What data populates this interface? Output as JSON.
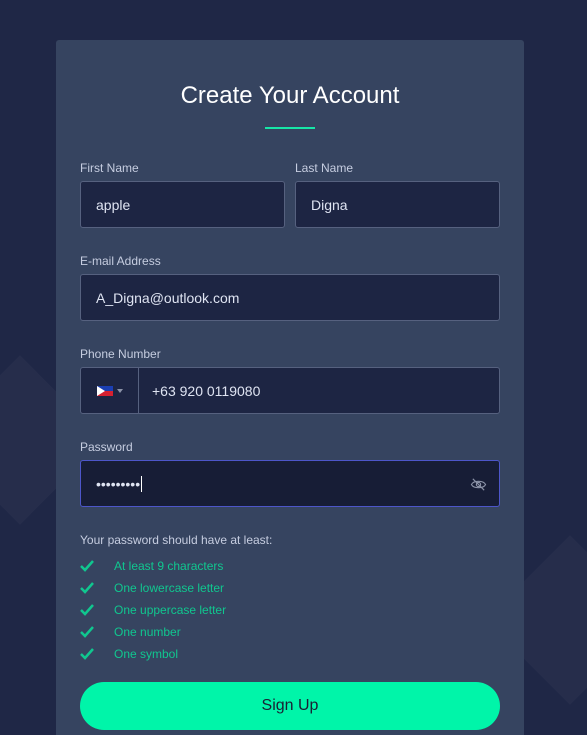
{
  "form": {
    "title": "Create Your Account",
    "first_name": {
      "label": "First Name",
      "value": "apple"
    },
    "last_name": {
      "label": "Last Name",
      "value": "Digna"
    },
    "email": {
      "label": "E-mail Address",
      "value": "A_Digna@outlook.com"
    },
    "phone": {
      "label": "Phone Number",
      "country_flag": "philippines-flag-icon",
      "value": "+63 920 0119080"
    },
    "password": {
      "label": "Password",
      "masked_value": "•••••••••"
    },
    "requirements_title": "Your password should have at least:",
    "requirements": [
      "At least 9 characters",
      "One lowercase letter",
      "One uppercase letter",
      "One number",
      "One symbol"
    ],
    "submit_label": "Sign Up"
  },
  "colors": {
    "background": "#1f2746",
    "card": "#364460",
    "accent": "#00f5a9",
    "check_green": "#10c78f",
    "focus_border": "#4d56c9"
  }
}
